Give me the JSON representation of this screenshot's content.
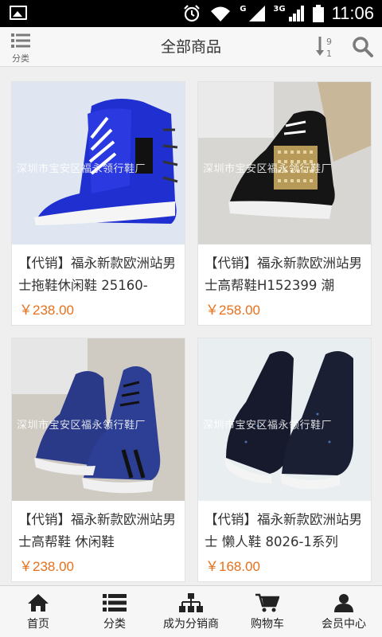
{
  "status_bar": {
    "time": "11:06",
    "network_1": "G",
    "network_2": "3G"
  },
  "header": {
    "title": "全部商品",
    "category_label": "分类"
  },
  "products": [
    {
      "name": "【代销】福永新款欧洲站男士拖鞋休闲鞋 25160-",
      "price": "￥238.00",
      "watermark": "深圳市宝安区福永领行鞋厂"
    },
    {
      "name": "【代销】福永新款欧洲站男士高帮鞋H152399 潮",
      "price": "￥258.00",
      "watermark": "深圳市宝安区福永领行鞋厂"
    },
    {
      "name": "【代销】福永新款欧洲站男士高帮鞋 休闲鞋",
      "price": "￥238.00",
      "watermark": "深圳市宝安区福永领行鞋厂"
    },
    {
      "name": "【代销】福永新款欧洲站男士 懒人鞋 8026-1系列",
      "price": "￥168.00",
      "watermark": "深圳市宝安区福永领行鞋厂"
    }
  ],
  "tabs": [
    {
      "label": "首页",
      "icon": "home-icon"
    },
    {
      "label": "分类",
      "icon": "list-icon"
    },
    {
      "label": "成为分销商",
      "icon": "org-chart-icon"
    },
    {
      "label": "购物车",
      "icon": "cart-icon"
    },
    {
      "label": "会员中心",
      "icon": "user-icon"
    }
  ],
  "colors": {
    "price": "#e8701a",
    "header_bg": "#f7f7f7",
    "page_bg": "#efefef"
  }
}
